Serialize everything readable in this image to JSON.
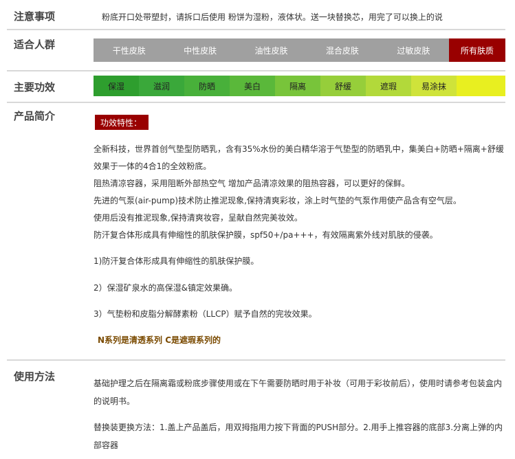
{
  "sections": {
    "notice": {
      "label": "注意事项",
      "text": "粉底开口处带塑封，请拆口后使用 粉饼为湿粉，液体状。送一块替换芯，用完了可以换上的说"
    },
    "skin": {
      "label": "适合人群",
      "items": [
        "干性皮肤",
        "中性皮肤",
        "油性皮肤",
        "混合皮肤",
        "过敏皮肤",
        "所有肤质"
      ],
      "active_index": 5,
      "bar_color": "#a0a0a0",
      "active_color": "#990000"
    },
    "effects": {
      "label": "主要功效",
      "items": [
        "保湿",
        "滋润",
        "防晒",
        "美白",
        "隔离",
        "舒缓",
        "遮瑕",
        "易涂抹"
      ],
      "colors": [
        "#2e9e2e",
        "#3aa83a",
        "#48b03a",
        "#5ab83a",
        "#78c43a",
        "#96ce3a",
        "#b2d93a",
        "#cfe33a",
        "#e8ef20"
      ]
    },
    "intro": {
      "label": "产品简介",
      "tag": "功效特性：",
      "lines": [
        "全新科技，世界首创气垫型防晒乳，含有35%水份的美白精华溶于气垫型的防晒乳中，集美白+防晒+隔离+舒缓",
        "效果于一体的4合1的全效粉底。",
        "阻热清凉容器，采用阻断外部热空气 增加产品清凉效果的阻热容器，可以更好的保鲜。",
        "先进的气泵(air-pump)技术防止推泥现象,保持清爽彩妆，涂上时气垫的气泵作用使产品含有空气层。",
        "使用后没有推泥现象,保持清爽妆容，呈献自然完美妆效。",
        "防汗复合体形成具有伸缩性的肌肤保护膜，spf50+/pa+++，有效隔离紫外线对肌肤的侵袭。"
      ],
      "points": [
        "1)防汗复合体形成具有伸缩性的肌肤保护膜。",
        "2）保湿矿泉水的高保湿&镇定效果确。",
        "3）气垫粉和皮脂分解酵素粉（LLCP）赋予自然的完妆效果。"
      ],
      "series": "N系列是清透系列   C是遮瑕系列的"
    },
    "usage": {
      "label": "使用方法",
      "line1": "基础护理之后在隔离霜或粉底步骤使用或在下午需要防晒时用于补妆（可用于彩妆前后），使用时请参考包装盒内",
      "line2": "的说明书。",
      "line3": "替换装更换方法：1.盖上产品盖后，用双拇指用力按下背面的PUSH部分。2.用手上推容器的底部3.分离上弹的内",
      "line4": "部容器"
    }
  }
}
